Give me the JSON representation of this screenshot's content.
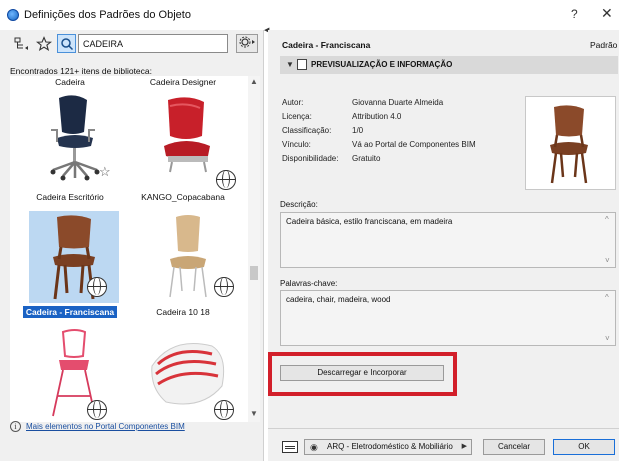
{
  "window": {
    "title": "Definições dos Padrões do Objeto",
    "help_label": "?",
    "close_label": "✕"
  },
  "library": {
    "search_value": "CADEIRA",
    "found_text": "Encontrados 121+ itens de biblioteca:",
    "top_labels": [
      "Cadeira",
      "Cadeira Designer"
    ],
    "items": [
      {
        "label": "Cadeira Escritório"
      },
      {
        "label": "KANGO_Copacabana"
      },
      {
        "label": "Cadeira - Franciscana"
      },
      {
        "label": "Cadeira 10 18"
      }
    ],
    "more_link": "Mais elementos no Portal Componentes BIM"
  },
  "details": {
    "object_name": "Cadeira - Franciscana",
    "default_label": "Padrão",
    "section_title": "PREVISUALIZAÇÃO E INFORMAÇÃO",
    "info": [
      {
        "key": "Autor:",
        "value": "Giovanna Duarte Almeida"
      },
      {
        "key": "Licença:",
        "value": "Attribution 4.0"
      },
      {
        "key": "Classificação:",
        "value": "1/0"
      },
      {
        "key": "Vínculo:",
        "value": "Vá ao Portal de Componentes BIM"
      },
      {
        "key": "Disponibilidade:",
        "value": "Gratuito"
      }
    ],
    "description_label": "Descrição:",
    "description": "Cadeira básica, estilo franciscana, em madeira",
    "keywords_label": "Palavras-chave:",
    "keywords": "cadeira, chair, madeira, wood",
    "download_button": "Descarregar e Incorporar"
  },
  "footer": {
    "category": "ARQ - Eletrodoméstico & Mobiliário",
    "cancel": "Cancelar",
    "ok": "OK"
  },
  "colors": {
    "selection": "#1a62c4",
    "highlight": "#d21f2a",
    "link": "#1a4fa0"
  }
}
